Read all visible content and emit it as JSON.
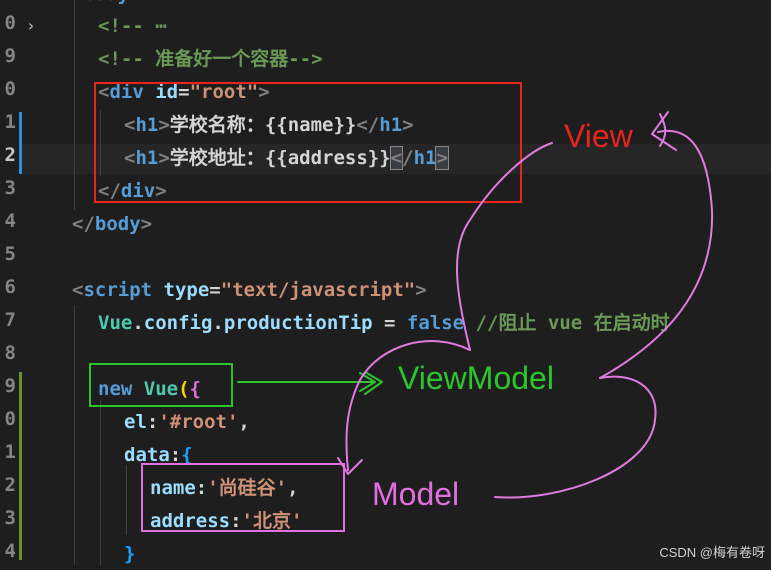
{
  "editor": {
    "line_numbers": [
      "0",
      "9",
      "0",
      "1",
      "2",
      "3",
      "4",
      "5",
      "6",
      "7",
      "8",
      "9",
      "0",
      "1",
      "2",
      "3",
      "4"
    ],
    "lines": {
      "l0_comment": "<!-- ⋯",
      "l1_comment": "<!-- 准备好一个容器-->",
      "l2_lt": "<",
      "l2_tag": "div",
      "l2_attr": " id",
      "l2_eq": "=",
      "l2_val": "\"root\"",
      "l2_gt": ">",
      "l3_open_lt": "<",
      "l3_tag": "h1",
      "l3_open_gt": ">",
      "l3_text": "学校名称：",
      "l3_b1": "{{",
      "l3_expr": "name",
      "l3_b2": "}}",
      "l3_close_lt": "</",
      "l3_close_tag": "h1",
      "l3_close_gt": ">",
      "l4_open_lt": "<",
      "l4_tag": "h1",
      "l4_open_gt": ">",
      "l4_text": "学校地址：",
      "l4_b1": "{{",
      "l4_expr": "address",
      "l4_b2": "}}",
      "l4_close_lt": "<",
      "l4_close_slash": "/",
      "l4_close_tag": "h1",
      "l4_close_gt": ">",
      "l5_lt": "</",
      "l5_tag": "div",
      "l5_gt": ">",
      "l6_lt": "</",
      "l6_tag": "body",
      "l6_gt": ">",
      "l8_lt": "<",
      "l8_tag": "script",
      "l8_attr": " type",
      "l8_eq": "=",
      "l8_val": "\"text/javascript\"",
      "l8_gt": ">",
      "l9_obj": "Vue",
      "l9_dot1": ".",
      "l9_p1": "config",
      "l9_dot2": ".",
      "l9_p2": "productionTip",
      "l9_eq": " = ",
      "l9_kw": "false",
      "l9_cmt": " //阻止 vue 在启动时",
      "l11_new": "new",
      "l11_cls": " Vue",
      "l11_paren": "(",
      "l11_brace": "{",
      "l12_key": "el",
      "l12_colon": ":",
      "l12_val": "'#root'",
      "l12_comma": ",",
      "l13_key": "data",
      "l13_colon": ":",
      "l13_brace": "{",
      "l14_key": "name",
      "l14_colon": ":",
      "l14_val": "'尚硅谷'",
      "l14_comma": ",",
      "l15_key": "address",
      "l15_colon": ":",
      "l15_val": "'北京'",
      "l16_brace": "}",
      "l_top": "body"
    }
  },
  "annotations": {
    "view_label": "View",
    "viewmodel_label": "ViewModel",
    "model_label": "Model",
    "colors": {
      "view": "#e8251c",
      "viewmodel": "#2dc52d",
      "model": "#e06fe0",
      "arrows": "#e07ae0",
      "green_arrow": "#2dc52d"
    }
  },
  "watermark": "CSDN @梅有卷呀"
}
